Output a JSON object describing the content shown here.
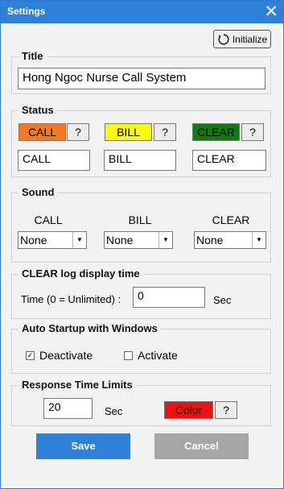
{
  "window": {
    "title": "Settings",
    "close_icon": "close-icon"
  },
  "toolbar": {
    "initialize_label": "Initialize",
    "initialize_icon": "refresh-icon"
  },
  "title_group": {
    "label": "Title",
    "value": "Hong Ngoc Nurse Call System"
  },
  "status_group": {
    "label": "Status",
    "items": [
      {
        "button_label": "CALL",
        "color": "#f47b20",
        "help_label": "?",
        "value": "CALL"
      },
      {
        "button_label": "BILL",
        "color": "#fbfb12",
        "help_label": "?",
        "value": "BILL"
      },
      {
        "button_label": "CLEAR",
        "color": "#107c10",
        "help_label": "?",
        "value": "CLEAR"
      }
    ]
  },
  "sound_group": {
    "label": "Sound",
    "items": [
      {
        "heading": "CALL",
        "selected": "None"
      },
      {
        "heading": "BILL",
        "selected": "None"
      },
      {
        "heading": "CLEAR",
        "selected": "None"
      }
    ]
  },
  "clear_log_group": {
    "label": "CLEAR log display time",
    "time_label": "Time (0 = Unlimited) :",
    "value": "0",
    "unit": "Sec"
  },
  "auto_startup_group": {
    "label": "Auto Startup with Windows",
    "deactivate_label": "Deactivate",
    "deactivate_checked": true,
    "activate_label": "Activate",
    "activate_checked": false
  },
  "response_group": {
    "label": "Response Time Limits",
    "value": "20",
    "unit": "Sec",
    "color_label": "Color",
    "color": "#ee1111",
    "help_label": "?"
  },
  "footer": {
    "save_label": "Save",
    "cancel_label": "Cancel",
    "save_color": "#2f80d8",
    "cancel_color": "#a6a6a6"
  }
}
